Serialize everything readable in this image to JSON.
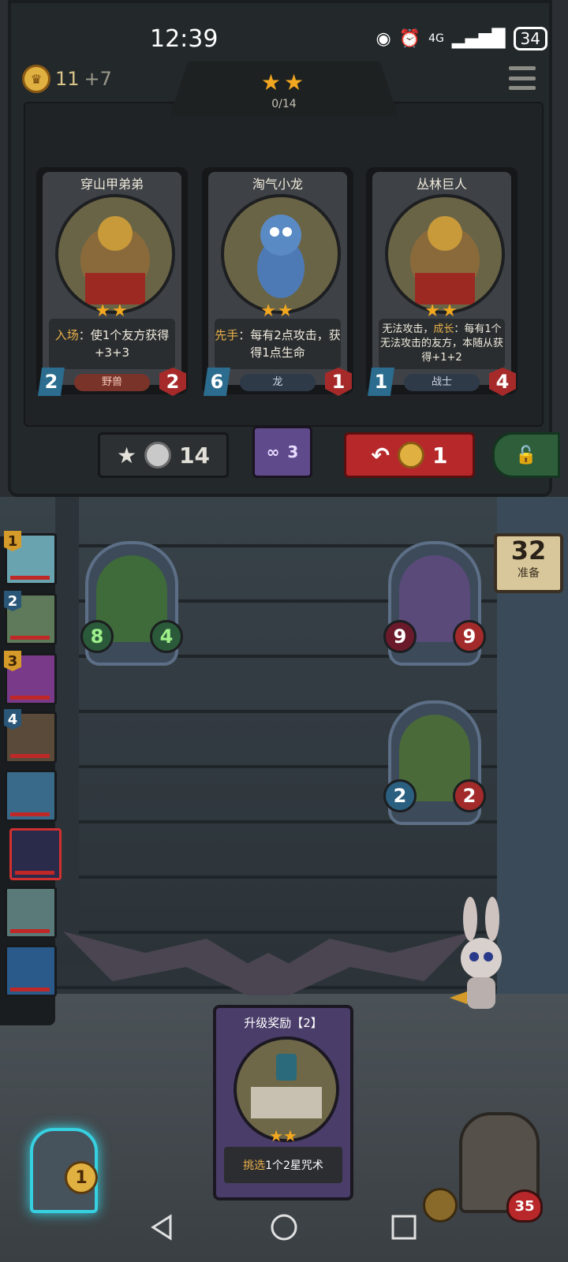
{
  "status_bar": {
    "time": "12:39",
    "network": "4G",
    "battery": "34"
  },
  "shop": {
    "gold": "11",
    "gold_income": "+7",
    "tier_stars": "★★",
    "tier_progress": "0/14",
    "cards": [
      {
        "name": "穿山甲弟弟",
        "stars": "★★",
        "desc_keyword": "入场",
        "desc_text": "：使1个友方获得+3+3",
        "attack": "2",
        "health": "2",
        "tribe": "野兽"
      },
      {
        "name": "淘气小龙",
        "stars": "★★",
        "desc_keyword": "先手",
        "desc_text": "：每有2点攻击，获得1点生命",
        "attack": "6",
        "health": "1",
        "tribe": "龙"
      },
      {
        "name": "丛林巨人",
        "stars": "★★",
        "desc_prefix": "无法攻击，",
        "desc_keyword": "成长",
        "desc_text": "：每有1个无法攻击的友方，本随从获得+1+2",
        "attack": "1",
        "health": "4",
        "tribe": "战士"
      }
    ],
    "upgrade_cost": "14",
    "freeze_count": "3",
    "refresh_cost": "1"
  },
  "battle": {
    "timer": "32",
    "timer_label": "准备",
    "team_slots": [
      "1",
      "2",
      "3",
      "4"
    ],
    "minions": [
      {
        "attack": "8",
        "health": "4"
      },
      {
        "attack": "9",
        "health": "9"
      },
      {
        "attack": "2",
        "health": "2"
      }
    ]
  },
  "reward": {
    "title": "升级奖励【2】",
    "stars": "★★",
    "desc_keyword": "挑选",
    "desc_text": "1个2星咒术"
  },
  "hero": {
    "coin": "1",
    "opponent_health": "35"
  }
}
